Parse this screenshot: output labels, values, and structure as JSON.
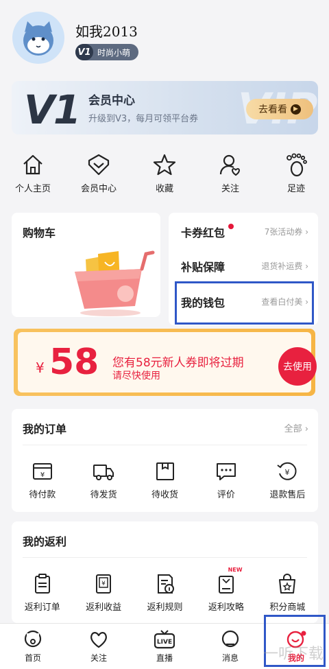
{
  "profile": {
    "username": "如我2013",
    "level": "V1",
    "level_title": "时尚小萌"
  },
  "member_card": {
    "big_label": "V1",
    "watermark": "VIP",
    "title": "会员中心",
    "subtitle": "升级到V3，每月可领平台券",
    "button": "去看看"
  },
  "quick_links": [
    {
      "label": "个人主页",
      "icon": "home-icon"
    },
    {
      "label": "会员中心",
      "icon": "diamond-icon"
    },
    {
      "label": "收藏",
      "icon": "star-icon"
    },
    {
      "label": "关注",
      "icon": "follow-user-icon"
    },
    {
      "label": "足迹",
      "icon": "footprint-icon"
    }
  ],
  "cart": {
    "title": "购物车"
  },
  "right_list": [
    {
      "label": "卡券红包",
      "hint": "7张活动券",
      "has_dot": true
    },
    {
      "label": "补贴保障",
      "hint": "退货补运费",
      "has_dot": false
    },
    {
      "label": "我的钱包",
      "hint": "查看白付美",
      "has_dot": false
    }
  ],
  "coupon": {
    "currency": "¥",
    "amount": "58",
    "message": "您有58元新人券即将过期",
    "sub": "请尽快使用",
    "button": "去使用"
  },
  "orders": {
    "title": "我的订单",
    "all": "全部",
    "items": [
      {
        "label": "待付款",
        "icon": "wallet-card-icon"
      },
      {
        "label": "待发货",
        "icon": "truck-icon"
      },
      {
        "label": "待收货",
        "icon": "box-icon"
      },
      {
        "label": "评价",
        "icon": "comment-icon"
      },
      {
        "label": "退款售后",
        "icon": "refund-icon"
      }
    ]
  },
  "rebate": {
    "title": "我的返利",
    "items": [
      {
        "label": "返利订单",
        "icon": "clipboard-icon"
      },
      {
        "label": "返利收益",
        "icon": "tablet-yen-icon"
      },
      {
        "label": "返利规则",
        "icon": "document-info-icon"
      },
      {
        "label": "返利攻略",
        "icon": "book-new-icon",
        "badge": "NEW"
      },
      {
        "label": "积分商城",
        "icon": "shopping-bag-icon"
      }
    ]
  },
  "tabbar": [
    {
      "label": "首页",
      "icon": "home-tab-icon",
      "active": false
    },
    {
      "label": "关注",
      "icon": "heart-icon",
      "active": false
    },
    {
      "label": "直播",
      "icon": "live-tv-icon",
      "active": false,
      "icon_text": "LIVE"
    },
    {
      "label": "消息",
      "icon": "message-icon",
      "active": false
    },
    {
      "label": "我的",
      "icon": "smile-icon",
      "active": true
    }
  ],
  "watermark": "一听下载",
  "colors": {
    "accent": "#e8213f",
    "highlight_box": "#2f57c7",
    "gold": "#f6b545"
  }
}
